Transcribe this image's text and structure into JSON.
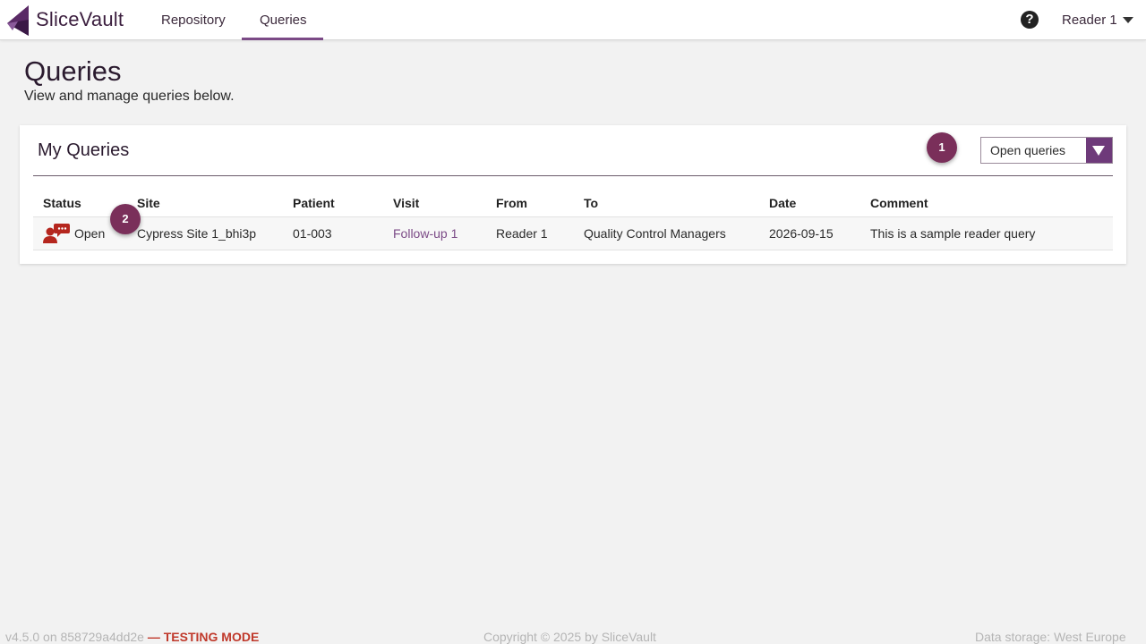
{
  "app": {
    "brand": "SliceVault"
  },
  "nav": {
    "items": [
      "Repository",
      "Queries"
    ],
    "active": "Queries"
  },
  "user": {
    "name": "Reader 1"
  },
  "page": {
    "title": "Queries",
    "subtitle": "View and manage queries below."
  },
  "card": {
    "title": "My Queries",
    "filter_value": "Open queries"
  },
  "badges": [
    "1",
    "2"
  ],
  "table": {
    "headers": [
      "Status",
      "Site",
      "Patient",
      "Visit",
      "From",
      "To",
      "Date",
      "Comment"
    ],
    "rows": [
      {
        "status": "Open",
        "site": "Cypress Site 1_bhi3p",
        "patient": "01-003",
        "visit": "Follow-up 1",
        "from": "Reader 1",
        "to": "Quality Control Managers",
        "date": "2026-09-15",
        "comment": "This is a sample reader query"
      }
    ]
  },
  "footer": {
    "version": "v4.5.0 on 858729a4dd2e",
    "mode": "— TESTING MODE",
    "copyright": "Copyright © 2025 by SliceVault",
    "storage": "Data storage: West Europe"
  },
  "colors": {
    "accent": "#6e3a7a",
    "badge": "#7a2f5a",
    "status_icon": "#b5261e",
    "testing": "#c0392b"
  },
  "icons": {
    "logo": "slicevault-logo",
    "help": "help-icon",
    "status": "open-query-icon"
  }
}
